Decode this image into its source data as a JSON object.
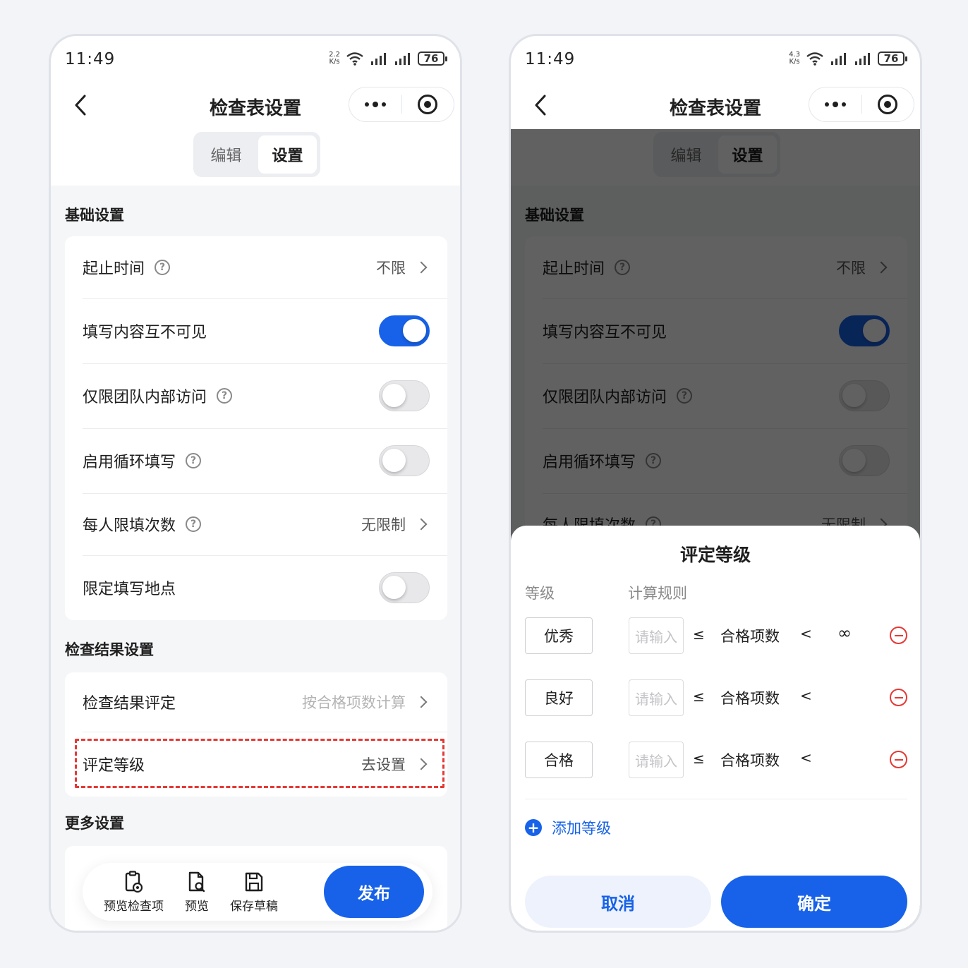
{
  "status": {
    "time": "11:49",
    "left_speed_value": "2.2",
    "right_speed_value": "4.3",
    "speed_unit": "K/s",
    "battery": "76"
  },
  "nav": {
    "title": "检查表设置"
  },
  "segment": {
    "edit": "编辑",
    "settings": "设置"
  },
  "basic": {
    "title": "基础设置",
    "start_end": {
      "label": "起止时间",
      "value": "不限"
    },
    "invisible": {
      "label": "填写内容互不可见",
      "on": true
    },
    "team_only": {
      "label": "仅限团队内部访问",
      "on": false
    },
    "cycle": {
      "label": "启用循环填写",
      "on": false
    },
    "limit_times": {
      "label": "每人限填次数",
      "value": "无限制"
    },
    "location": {
      "label": "限定填写地点",
      "on": false
    }
  },
  "result": {
    "title": "检查结果设置",
    "evaluation": {
      "label": "检查结果评定",
      "value": "按合格项数计算"
    },
    "level": {
      "label": "评定等级",
      "value": "去设置"
    }
  },
  "more": {
    "title": "更多设置"
  },
  "toolbar": {
    "preview_checklist": "预览检查项",
    "preview": "预览",
    "save_draft": "保存草稿",
    "publish": "发布"
  },
  "sheet": {
    "title": "评定等级",
    "col_level": "等级",
    "col_rule": "计算规则",
    "placeholder": "请输入",
    "le": "≤",
    "lt": "<",
    "metric": "合格项数",
    "infinity": "∞",
    "levels": [
      {
        "name": "优秀"
      },
      {
        "name": "良好"
      },
      {
        "name": "合格"
      }
    ],
    "add_level": "添加等级",
    "cancel": "取消",
    "confirm": "确定"
  },
  "colors": {
    "accent": "#1762e8",
    "danger": "#e53935"
  }
}
